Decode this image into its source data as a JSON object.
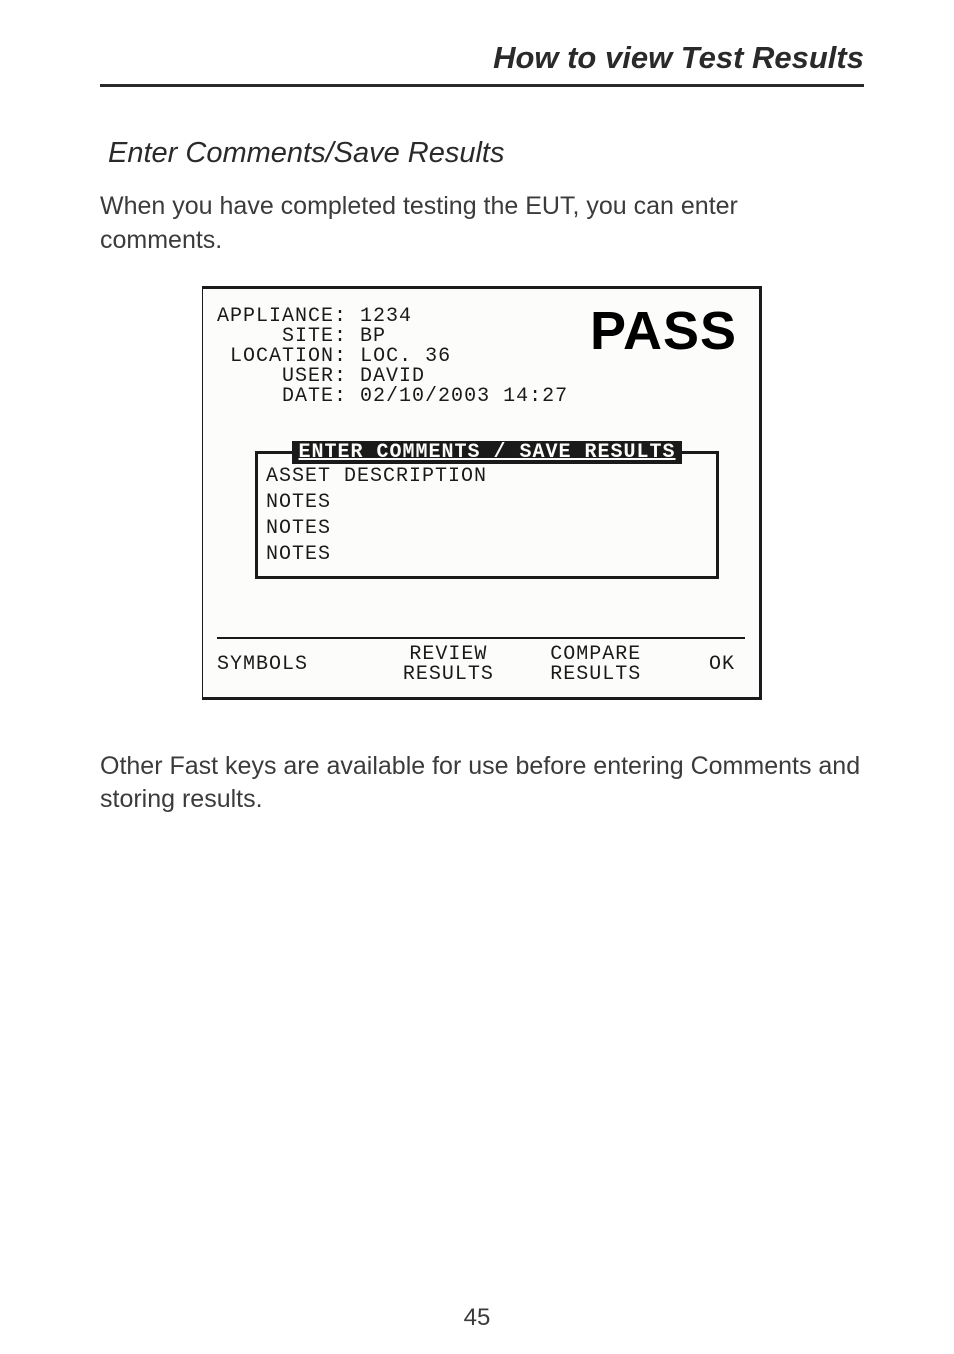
{
  "header": "How to view Test Results",
  "section_title": "Enter Comments/Save Results",
  "intro": "When you have completed testing the EUT, you can enter comments.",
  "screen": {
    "pass": "PASS",
    "fields": {
      "appliance_label": "APPLIANCE:",
      "appliance_value": "1234",
      "site_label": "SITE:",
      "site_value": "BP",
      "location_label": "LOCATION:",
      "location_value": "LOC. 36",
      "user_label": "USER:",
      "user_value": "DAVID",
      "date_label": "DATE:",
      "date_value": "02/10/2003 14:27"
    },
    "comments": {
      "legend": "ENTER COMMENTS / SAVE RESULTS",
      "lines": [
        "ASSET DESCRIPTION",
        "NOTES",
        "NOTES",
        "NOTES"
      ]
    },
    "softkeys": {
      "k1": "SYMBOLS",
      "k2": "REVIEW\nRESULTS",
      "k3": "COMPARE\nRESULTS",
      "k4": "OK"
    }
  },
  "outro": "Other Fast keys are available for use before entering Comments and storing results.",
  "page_number": "45"
}
